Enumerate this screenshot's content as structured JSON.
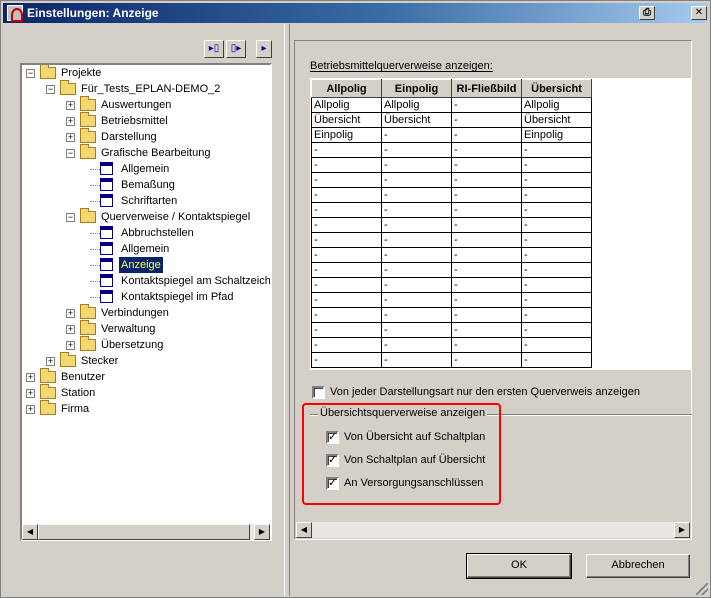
{
  "window": {
    "title": "Einstellungen: Anzeige",
    "print_glyph": "⎙",
    "close_glyph": "✕"
  },
  "toolbar": {
    "btn1_glyph": "▸▯",
    "btn2_glyph": "▯▸",
    "btn3_glyph": "▸"
  },
  "tree": {
    "items": [
      {
        "label": "Projekte",
        "expander": "−",
        "icon": "folder"
      },
      {
        "label": "Für_Tests_EPLAN-DEMO_2",
        "expander": "−",
        "icon": "folder"
      },
      {
        "label": "Auswertungen",
        "expander": "+",
        "icon": "folder"
      },
      {
        "label": "Betriebsmittel",
        "expander": "+",
        "icon": "folder"
      },
      {
        "label": "Darstellung",
        "expander": "+",
        "icon": "folder"
      },
      {
        "label": "Grafische Bearbeitung",
        "expander": "−",
        "icon": "folder"
      },
      {
        "label": "Allgemein",
        "expander": "",
        "icon": "page"
      },
      {
        "label": "Bemaßung",
        "expander": "",
        "icon": "page"
      },
      {
        "label": "Schriftarten",
        "expander": "",
        "icon": "page"
      },
      {
        "label": "Querverweise / Kontaktspiegel",
        "expander": "−",
        "icon": "folder"
      },
      {
        "label": "Abbruchstellen",
        "expander": "",
        "icon": "page"
      },
      {
        "label": "Allgemein",
        "expander": "",
        "icon": "page"
      },
      {
        "label": "Anzeige",
        "expander": "",
        "icon": "page",
        "selected": true
      },
      {
        "label": "Kontaktspiegel am Schaltzeiche",
        "expander": "",
        "icon": "page"
      },
      {
        "label": "Kontaktspiegel im Pfad",
        "expander": "",
        "icon": "page"
      },
      {
        "label": "Verbindungen",
        "expander": "+",
        "icon": "folder"
      },
      {
        "label": "Verwaltung",
        "expander": "+",
        "icon": "folder"
      },
      {
        "label": "Übersetzung",
        "expander": "+",
        "icon": "folder"
      },
      {
        "label": "Stecker",
        "expander": "+",
        "icon": "folder"
      },
      {
        "label": "Benutzer",
        "expander": "+",
        "icon": "folder"
      },
      {
        "label": "Station",
        "expander": "+",
        "icon": "folder"
      },
      {
        "label": "Firma",
        "expander": "+",
        "icon": "folder"
      }
    ]
  },
  "scroll": {
    "left": "◀",
    "right": "▶"
  },
  "xref": {
    "caption": "Betriebsmittelquerverweise anzeigen:",
    "columns": [
      "Allpolig",
      "Einpolig",
      "RI-Fließbild",
      "Übersicht"
    ],
    "rows": [
      [
        "Allpolig",
        "Allpolig",
        "-",
        "Allpolig"
      ],
      [
        "Übersicht",
        "Übersicht",
        "-",
        "Übersicht"
      ],
      [
        "Einpolig",
        "-",
        "-",
        "Einpolig"
      ],
      [
        "-",
        "-",
        "-",
        "-"
      ],
      [
        "-",
        "-",
        "-",
        "-"
      ],
      [
        "-",
        "-",
        "-",
        "-"
      ],
      [
        "-",
        "-",
        "-",
        "-"
      ],
      [
        "-",
        "-",
        "-",
        "-"
      ],
      [
        "-",
        "-",
        "-",
        "-"
      ],
      [
        "-",
        "-",
        "-",
        "-"
      ],
      [
        "-",
        "-",
        "-",
        "-"
      ],
      [
        "-",
        "-",
        "-",
        "-"
      ],
      [
        "-",
        "-",
        "-",
        "-"
      ],
      [
        "-",
        "-",
        "-",
        "-"
      ],
      [
        "-",
        "-",
        "-",
        "-"
      ],
      [
        "-",
        "-",
        "-",
        "-"
      ],
      [
        "-",
        "-",
        "-",
        "-"
      ],
      [
        "-",
        "-",
        "-",
        "-"
      ]
    ]
  },
  "options": {
    "first_xref": {
      "label": "Von jeder Darstellungsart nur den ersten Querverweis anzeigen",
      "checked": false
    },
    "group_title": "Übersichtsquerverweise anzeigen",
    "overview_to_schematic": {
      "label": "Von Übersicht auf Schaltplan",
      "checked": true
    },
    "schematic_to_overview": {
      "label": "Von Schaltplan auf Übersicht",
      "checked": true
    },
    "supply_connections": {
      "label": "An Versorgungsanschlüssen",
      "checked": true
    }
  },
  "buttons": {
    "ok": "OK",
    "cancel": "Abbrechen"
  },
  "colors": {
    "highlight": "#ff0000",
    "selection_bg": "#0a246a",
    "selection_fg": "#ffff40"
  }
}
